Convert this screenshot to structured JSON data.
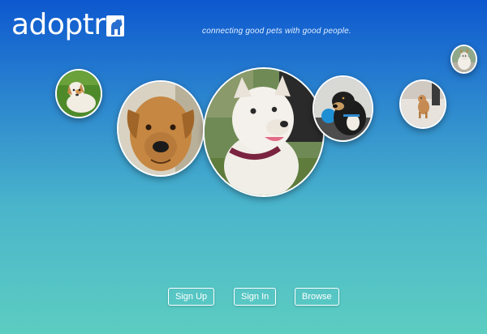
{
  "brand": {
    "name": "adoptr",
    "tagline": "connecting good pets with good people."
  },
  "gallery": {
    "photos": [
      {
        "name": "jack-russell-on-grass-photo"
      },
      {
        "name": "tan-boxer-mix-photo"
      },
      {
        "name": "white-pit-bull-photo"
      },
      {
        "name": "black-tan-dog-with-ball-photo"
      },
      {
        "name": "small-dog-on-floor-photo"
      },
      {
        "name": "small-terrier-photo"
      }
    ]
  },
  "actions": {
    "sign_up": "Sign Up",
    "sign_in": "Sign In",
    "browse": "Browse"
  }
}
